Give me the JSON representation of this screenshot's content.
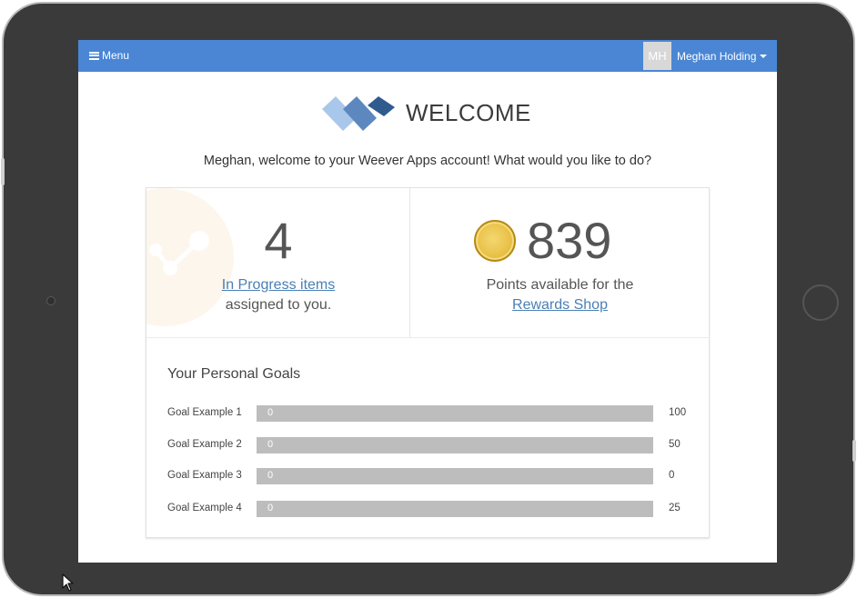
{
  "navbar": {
    "menu_label": "Menu",
    "user_initials": "MH",
    "user_name": "Meghan Holding",
    "bar_color": "#4a86d4"
  },
  "header": {
    "title": "WELCOME",
    "subtitle": "Meghan, welcome to your Weever Apps account! What would you like to do?"
  },
  "in_progress": {
    "count": "4",
    "link_text": "In Progress items",
    "text": "assigned to you."
  },
  "points": {
    "value": "839",
    "text": "Points available for the",
    "link_text": "Rewards Shop"
  },
  "goals": {
    "title": "Your Personal Goals",
    "items": [
      {
        "label": "Goal Example 1",
        "progress": "0",
        "target": "100",
        "fraction": 0
      },
      {
        "label": "Goal Example 2",
        "progress": "0",
        "target": "50",
        "fraction": 0
      },
      {
        "label": "Goal Example 3",
        "progress": "0",
        "target": "0",
        "fraction": 0
      },
      {
        "label": "Goal Example 4",
        "progress": "0",
        "target": "25",
        "fraction": 0
      }
    ]
  },
  "icons": {
    "menu": "hamburger-icon",
    "dropdown": "caret-down-icon",
    "logo": "weever-logo",
    "coin": "coin-icon",
    "background": "share-icon"
  },
  "colors": {
    "accent": "#4a86d4",
    "link": "#4a7fb5",
    "coin": "#e8c046",
    "bar_track": "#bdbdbd"
  }
}
